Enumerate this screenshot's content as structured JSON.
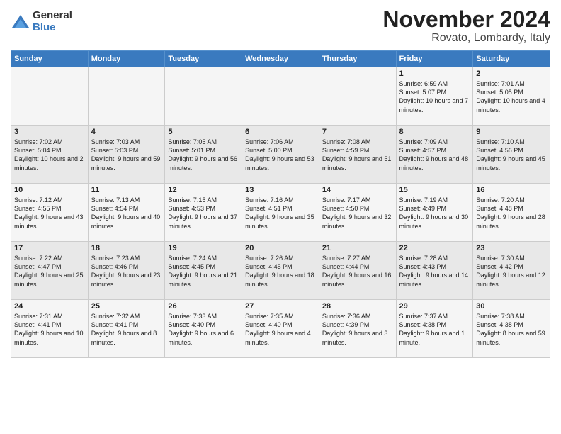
{
  "header": {
    "logo_general": "General",
    "logo_blue": "Blue",
    "month": "November 2024",
    "location": "Rovato, Lombardy, Italy"
  },
  "days_of_week": [
    "Sunday",
    "Monday",
    "Tuesday",
    "Wednesday",
    "Thursday",
    "Friday",
    "Saturday"
  ],
  "weeks": [
    [
      {
        "day": "",
        "info": ""
      },
      {
        "day": "",
        "info": ""
      },
      {
        "day": "",
        "info": ""
      },
      {
        "day": "",
        "info": ""
      },
      {
        "day": "",
        "info": ""
      },
      {
        "day": "1",
        "info": "Sunrise: 6:59 AM\nSunset: 5:07 PM\nDaylight: 10 hours and 7 minutes."
      },
      {
        "day": "2",
        "info": "Sunrise: 7:01 AM\nSunset: 5:05 PM\nDaylight: 10 hours and 4 minutes."
      }
    ],
    [
      {
        "day": "3",
        "info": "Sunrise: 7:02 AM\nSunset: 5:04 PM\nDaylight: 10 hours and 2 minutes."
      },
      {
        "day": "4",
        "info": "Sunrise: 7:03 AM\nSunset: 5:03 PM\nDaylight: 9 hours and 59 minutes."
      },
      {
        "day": "5",
        "info": "Sunrise: 7:05 AM\nSunset: 5:01 PM\nDaylight: 9 hours and 56 minutes."
      },
      {
        "day": "6",
        "info": "Sunrise: 7:06 AM\nSunset: 5:00 PM\nDaylight: 9 hours and 53 minutes."
      },
      {
        "day": "7",
        "info": "Sunrise: 7:08 AM\nSunset: 4:59 PM\nDaylight: 9 hours and 51 minutes."
      },
      {
        "day": "8",
        "info": "Sunrise: 7:09 AM\nSunset: 4:57 PM\nDaylight: 9 hours and 48 minutes."
      },
      {
        "day": "9",
        "info": "Sunrise: 7:10 AM\nSunset: 4:56 PM\nDaylight: 9 hours and 45 minutes."
      }
    ],
    [
      {
        "day": "10",
        "info": "Sunrise: 7:12 AM\nSunset: 4:55 PM\nDaylight: 9 hours and 43 minutes."
      },
      {
        "day": "11",
        "info": "Sunrise: 7:13 AM\nSunset: 4:54 PM\nDaylight: 9 hours and 40 minutes."
      },
      {
        "day": "12",
        "info": "Sunrise: 7:15 AM\nSunset: 4:53 PM\nDaylight: 9 hours and 37 minutes."
      },
      {
        "day": "13",
        "info": "Sunrise: 7:16 AM\nSunset: 4:51 PM\nDaylight: 9 hours and 35 minutes."
      },
      {
        "day": "14",
        "info": "Sunrise: 7:17 AM\nSunset: 4:50 PM\nDaylight: 9 hours and 32 minutes."
      },
      {
        "day": "15",
        "info": "Sunrise: 7:19 AM\nSunset: 4:49 PM\nDaylight: 9 hours and 30 minutes."
      },
      {
        "day": "16",
        "info": "Sunrise: 7:20 AM\nSunset: 4:48 PM\nDaylight: 9 hours and 28 minutes."
      }
    ],
    [
      {
        "day": "17",
        "info": "Sunrise: 7:22 AM\nSunset: 4:47 PM\nDaylight: 9 hours and 25 minutes."
      },
      {
        "day": "18",
        "info": "Sunrise: 7:23 AM\nSunset: 4:46 PM\nDaylight: 9 hours and 23 minutes."
      },
      {
        "day": "19",
        "info": "Sunrise: 7:24 AM\nSunset: 4:45 PM\nDaylight: 9 hours and 21 minutes."
      },
      {
        "day": "20",
        "info": "Sunrise: 7:26 AM\nSunset: 4:45 PM\nDaylight: 9 hours and 18 minutes."
      },
      {
        "day": "21",
        "info": "Sunrise: 7:27 AM\nSunset: 4:44 PM\nDaylight: 9 hours and 16 minutes."
      },
      {
        "day": "22",
        "info": "Sunrise: 7:28 AM\nSunset: 4:43 PM\nDaylight: 9 hours and 14 minutes."
      },
      {
        "day": "23",
        "info": "Sunrise: 7:30 AM\nSunset: 4:42 PM\nDaylight: 9 hours and 12 minutes."
      }
    ],
    [
      {
        "day": "24",
        "info": "Sunrise: 7:31 AM\nSunset: 4:41 PM\nDaylight: 9 hours and 10 minutes."
      },
      {
        "day": "25",
        "info": "Sunrise: 7:32 AM\nSunset: 4:41 PM\nDaylight: 9 hours and 8 minutes."
      },
      {
        "day": "26",
        "info": "Sunrise: 7:33 AM\nSunset: 4:40 PM\nDaylight: 9 hours and 6 minutes."
      },
      {
        "day": "27",
        "info": "Sunrise: 7:35 AM\nSunset: 4:40 PM\nDaylight: 9 hours and 4 minutes."
      },
      {
        "day": "28",
        "info": "Sunrise: 7:36 AM\nSunset: 4:39 PM\nDaylight: 9 hours and 3 minutes."
      },
      {
        "day": "29",
        "info": "Sunrise: 7:37 AM\nSunset: 4:38 PM\nDaylight: 9 hours and 1 minute."
      },
      {
        "day": "30",
        "info": "Sunrise: 7:38 AM\nSunset: 4:38 PM\nDaylight: 8 hours and 59 minutes."
      }
    ]
  ]
}
